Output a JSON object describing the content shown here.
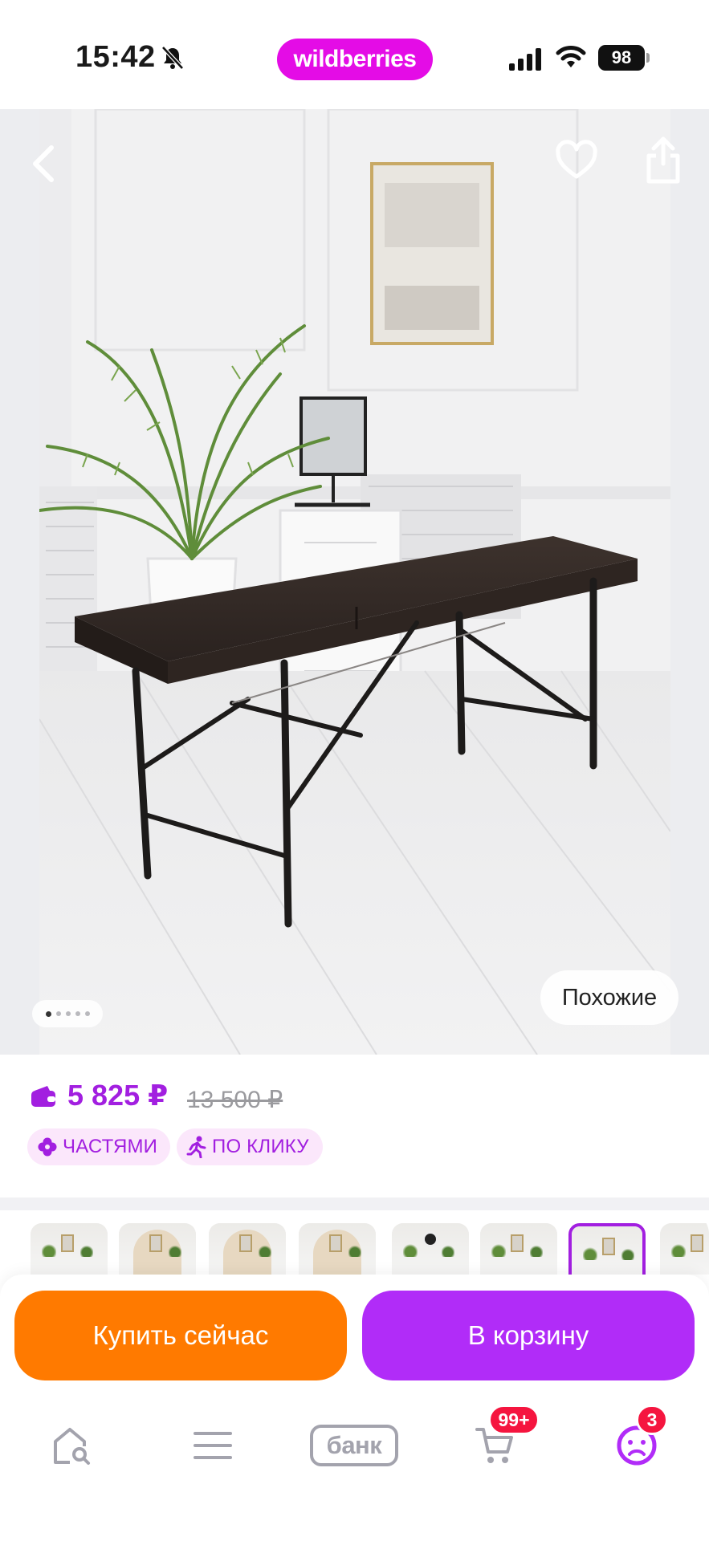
{
  "status_bar": {
    "time": "15:42",
    "battery": "98",
    "brand": "wildberries"
  },
  "gallery": {
    "similar_label": "Похожие",
    "dots_count": 5,
    "active_dot": 0
  },
  "product": {
    "price": "5 825 ₽",
    "old_price": "13 500 ₽",
    "chips": [
      {
        "label": "ЧАСТЯМИ",
        "icon": "clover-icon"
      },
      {
        "label": "ПО КЛИКУ",
        "icon": "running-person-icon"
      }
    ]
  },
  "actions": {
    "buy_now": "Купить сейчас",
    "add_to_cart": "В корзину"
  },
  "tab_bar": {
    "bank_label": "банк",
    "cart_badge": "99+",
    "profile_badge": "3"
  },
  "colors": {
    "brand": "#e40ce6",
    "price": "#a21fe0",
    "buy_now": "#ff7a00",
    "add_to_cart": "#b12cf8",
    "badge": "#f5153f"
  }
}
